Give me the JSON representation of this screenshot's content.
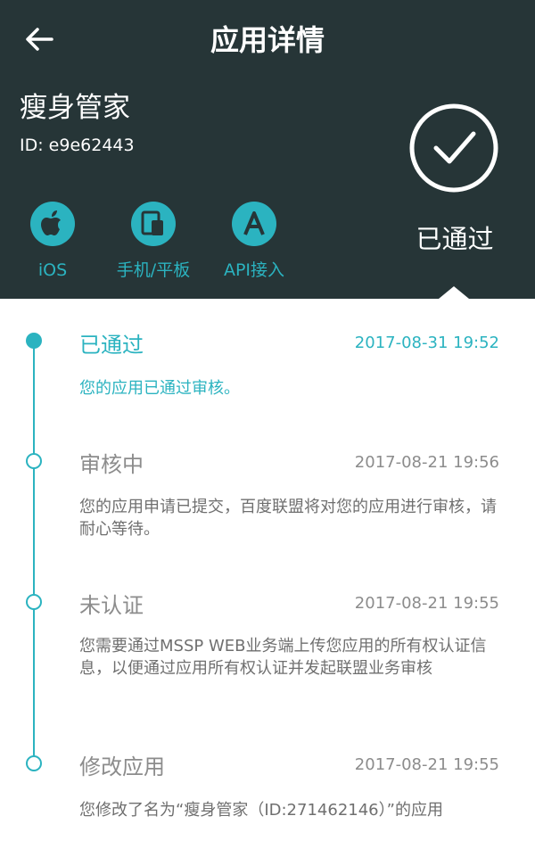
{
  "header": {
    "title": "应用详情",
    "app_name": "瘦身管家",
    "app_id": "ID: e9e62443"
  },
  "platforms": [
    {
      "label": "iOS",
      "icon": "apple-icon"
    },
    {
      "label": "手机/平板",
      "icon": "phone-tablet-icon"
    },
    {
      "label": "API接入",
      "icon": "api-icon"
    }
  ],
  "status": {
    "label": "已通过",
    "icon": "check-circle-icon"
  },
  "timeline": [
    {
      "status": "已通过",
      "time": "2017-08-31 19:52",
      "description": "您的应用已通过审核。"
    },
    {
      "status": "审核中",
      "time": "2017-08-21 19:56",
      "description": "您的应用申请已提交，百度联盟将对您的应用进行审核，请耐心等待。"
    },
    {
      "status": "未认证",
      "time": "2017-08-21 19:55",
      "description": "您需要通过MSSP WEB业务端上传您应用的所有权认证信息，以便通过应用所有权认证并发起联盟业务审核"
    },
    {
      "status": "修改应用",
      "time": "2017-08-21 19:55",
      "description": "您修改了名为“瘦身管家（ID:271462146）”的应用"
    }
  ],
  "colors": {
    "header_bg": "#263537",
    "accent": "#2bb3c0",
    "muted_text": "#8c8c8c"
  }
}
